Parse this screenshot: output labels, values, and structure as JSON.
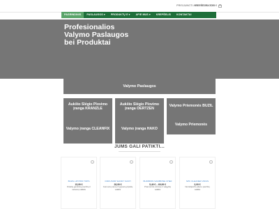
{
  "header": {
    "account_links": "PRISIJUNGTI / REGISTRUOTIS",
    "cart_label": "KREPŠELIS / 0,00 €",
    "cart_icon": "shopping-basket-icon"
  },
  "nav": {
    "items": [
      {
        "label": "PAGRINDINIS"
      },
      {
        "label": "PASLAUGOS ▾"
      },
      {
        "label": "PRODUKTŲ E ▾"
      },
      {
        "label": "APIE MUS ▾"
      },
      {
        "label": "KREPŠELIS"
      },
      {
        "label": "KONTAKTAI"
      }
    ]
  },
  "hero": {
    "title": "Profesionalios Valymo Paslaugos bei Produktai"
  },
  "categories": {
    "services": "Valymo Paslaugos",
    "tile1_a": "Aukšto Slėgio Plovimo įranga KRANZLE",
    "tile1_b": "Valymo įranga CLEANFIX",
    "tile2_a": "Aukšto Slėgio Plovimo įranga OERTZEN",
    "tile2_b": "Valymo įranga HAKO",
    "tile3_a": "Valymo Priemonės BUZIL",
    "tile3_b": "Valymo Priemonės"
  },
  "products_section": {
    "title": "JUMS GALI PATIKTI...",
    "items": [
      {
        "name": "BUZIL LIP PRO TOPS",
        "price": "15,99 €",
        "desc": "Didelių gamtinių paviršių ir nešvarų valiklis"
      },
      {
        "name": "DIFFUSOR SANDY SUCH",
        "price": "28,99 €",
        "desc": "Gumuotų sienų ir lygiuotų plytelių valiklis"
      },
      {
        "name": "BUDIBION SANIBONE CHEF",
        "price": "5,49 € – 69,99 €",
        "desc": "Pramoninis virtuvių ir valgyklų valiklis"
      },
      {
        "name": "SPC CLEANER VIRUS",
        "price": "3,99 €",
        "desc": "Nerūdijančio plieno paviršių valiklis"
      }
    ]
  }
}
